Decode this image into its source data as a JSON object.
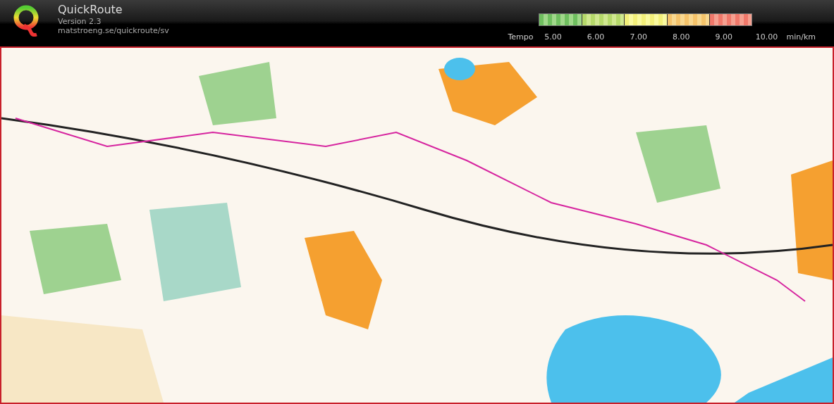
{
  "header": {
    "title": "QuickRoute",
    "version": "Version 2.3",
    "url": "matstroeng.se/quickroute/sv"
  },
  "legend": {
    "label": "Tempo",
    "ticks": [
      "5.00",
      "6.00",
      "7.00",
      "8.00",
      "9.00",
      "10.00"
    ],
    "unit": "min/km"
  }
}
